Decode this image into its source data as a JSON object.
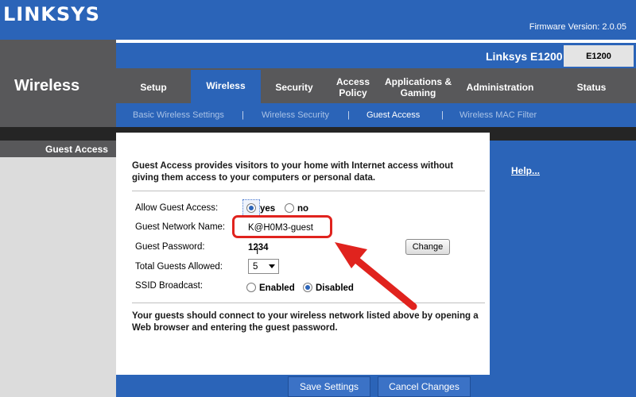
{
  "brand": {
    "logo": "LINKSYS",
    "firmware": "Firmware Version: 2.0.05"
  },
  "header": {
    "section_title": "Wireless",
    "model_name": "Linksys E1200",
    "model_badge": "E1200"
  },
  "tabs": [
    {
      "label": "Setup"
    },
    {
      "label": "Wireless"
    },
    {
      "label": "Security"
    },
    {
      "label": "Access Policy"
    },
    {
      "label": "Applications & Gaming"
    },
    {
      "label": "Administration"
    },
    {
      "label": "Status"
    }
  ],
  "active_tab": "Wireless",
  "subtabs": [
    {
      "label": "Basic Wireless Settings"
    },
    {
      "label": "Wireless Security"
    },
    {
      "label": "Guest Access"
    },
    {
      "label": "Wireless MAC Filter"
    }
  ],
  "subtab_separator": "|",
  "active_subtab": "Guest Access",
  "sidebar": {
    "label": "Guest Access"
  },
  "help": {
    "link": "Help..."
  },
  "content": {
    "intro": "Guest Access provides visitors to your home with Internet access without giving them access to your computers or personal data.",
    "allow_guest_access": {
      "label": "Allow Guest Access:",
      "yes": "yes",
      "no": "no",
      "selected": "yes"
    },
    "network_name": {
      "label": "Guest Network Name:",
      "value": "K@H0M3-guest"
    },
    "password": {
      "label": "Guest Password:",
      "value": "1234",
      "change_button": "Change"
    },
    "total_guests": {
      "label": "Total Guests Allowed:",
      "value": "5"
    },
    "ssid_broadcast": {
      "label": "SSID Broadcast:",
      "enabled": "Enabled",
      "disabled": "Disabled",
      "selected": "Disabled"
    },
    "footer_note": "Your guests should connect to your wireless network listed above by opening a Web browser and entering the guest password."
  },
  "buttons": {
    "save": "Save Settings",
    "cancel": "Cancel Changes"
  },
  "colors": {
    "brand_blue": "#2b64b8",
    "tab_grey": "#58585a",
    "annotation_red": "#e0231e"
  },
  "cursor_glyph": "I"
}
